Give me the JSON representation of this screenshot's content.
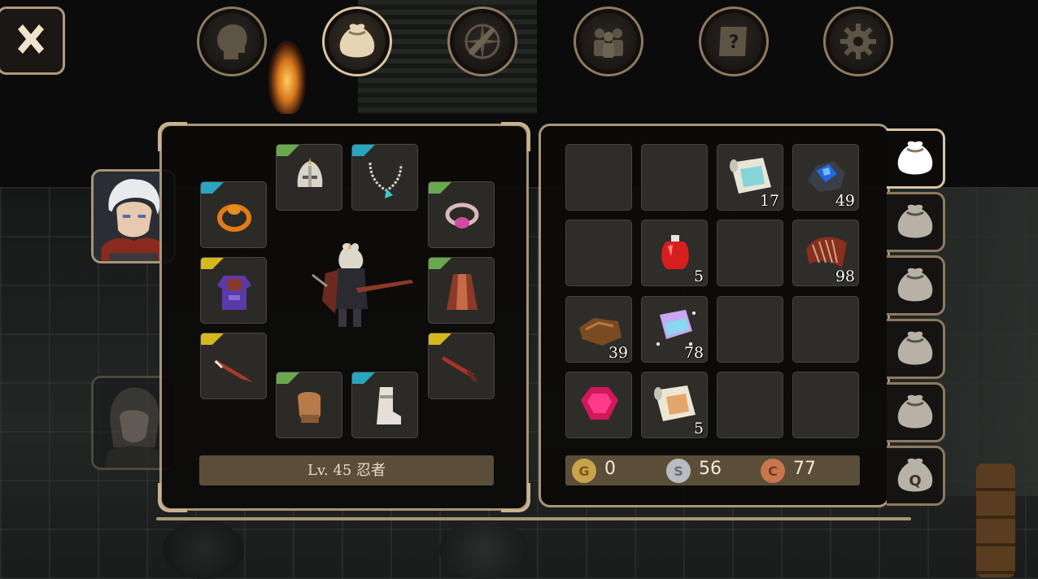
{
  "top_tabs": [
    {
      "name": "character",
      "icon": "head-silhouette-icon",
      "active": false
    },
    {
      "name": "inventory",
      "icon": "bag-icon",
      "active": true
    },
    {
      "name": "skills",
      "icon": "compass-sword-icon",
      "active": false
    },
    {
      "name": "party",
      "icon": "people-icon",
      "active": false
    },
    {
      "name": "quests",
      "icon": "scroll-question-icon",
      "active": false
    },
    {
      "name": "settings",
      "icon": "gear-icon",
      "active": false
    }
  ],
  "character": {
    "level_label": "Lv. 45 忍者"
  },
  "party": [
    {
      "name": "white-haired-hero",
      "selected": true
    },
    {
      "name": "dark-haired-ally",
      "selected": false
    }
  ],
  "equipment": [
    {
      "slot": "helmet",
      "icon": "helmet-icon",
      "rarity": "#6aa84f"
    },
    {
      "slot": "necklace",
      "icon": "necklace-icon",
      "rarity": "#2aa5c0"
    },
    {
      "slot": "ring-left",
      "icon": "ring-orange-icon",
      "rarity": "#2aa5c0"
    },
    {
      "slot": "ring-right",
      "icon": "ring-pink-icon",
      "rarity": "#6aa84f"
    },
    {
      "slot": "armor",
      "icon": "purple-armor-icon",
      "rarity": "#d4b81e"
    },
    {
      "slot": "cloak",
      "icon": "cloak-icon",
      "rarity": "#6aa84f"
    },
    {
      "slot": "weapon-offhand",
      "icon": "dagger-icon",
      "rarity": "#d4b81e"
    },
    {
      "slot": "weapon-main",
      "icon": "sword-icon",
      "rarity": "#d4b81e"
    },
    {
      "slot": "gloves",
      "icon": "glove-icon",
      "rarity": "#6aa84f"
    },
    {
      "slot": "boots",
      "icon": "boot-icon",
      "rarity": "#2aa5c0"
    }
  ],
  "inventory": {
    "rows": [
      [
        {
          "icon": "",
          "qty": ""
        },
        {
          "icon": "",
          "qty": ""
        },
        {
          "icon": "blue-scroll-icon",
          "qty": "17"
        },
        {
          "icon": "blue-ore-icon",
          "qty": "49"
        }
      ],
      [
        {
          "icon": "",
          "qty": ""
        },
        {
          "icon": "red-potion-icon",
          "qty": "5"
        },
        {
          "icon": "",
          "qty": ""
        },
        {
          "icon": "feather-claw-icon",
          "qty": "98"
        }
      ],
      [
        {
          "icon": "leather-scrap-icon",
          "qty": "39"
        },
        {
          "icon": "magic-cloth-icon",
          "qty": "78"
        },
        {
          "icon": "",
          "qty": ""
        },
        {
          "icon": "",
          "qty": ""
        }
      ],
      [
        {
          "icon": "ruby-gem-icon",
          "qty": ""
        },
        {
          "icon": "orange-scroll-icon",
          "qty": "5"
        },
        {
          "icon": "",
          "qty": ""
        },
        {
          "icon": "",
          "qty": ""
        }
      ]
    ]
  },
  "currency": {
    "gold": {
      "letter": "G",
      "value": "0",
      "color": "#c9a24a"
    },
    "silver": {
      "letter": "S",
      "value": "56",
      "color": "#b8bcc0"
    },
    "copper": {
      "letter": "C",
      "value": "77",
      "color": "#c7764e"
    }
  },
  "bag_tabs": [
    {
      "icon": "bag-icon",
      "active": true
    },
    {
      "icon": "bag-icon",
      "active": false
    },
    {
      "icon": "bag-icon",
      "active": false
    },
    {
      "icon": "bag-icon",
      "active": false
    },
    {
      "icon": "bag-icon",
      "active": false
    },
    {
      "icon": "quest-bag-icon",
      "label": "Q",
      "active": false
    }
  ]
}
